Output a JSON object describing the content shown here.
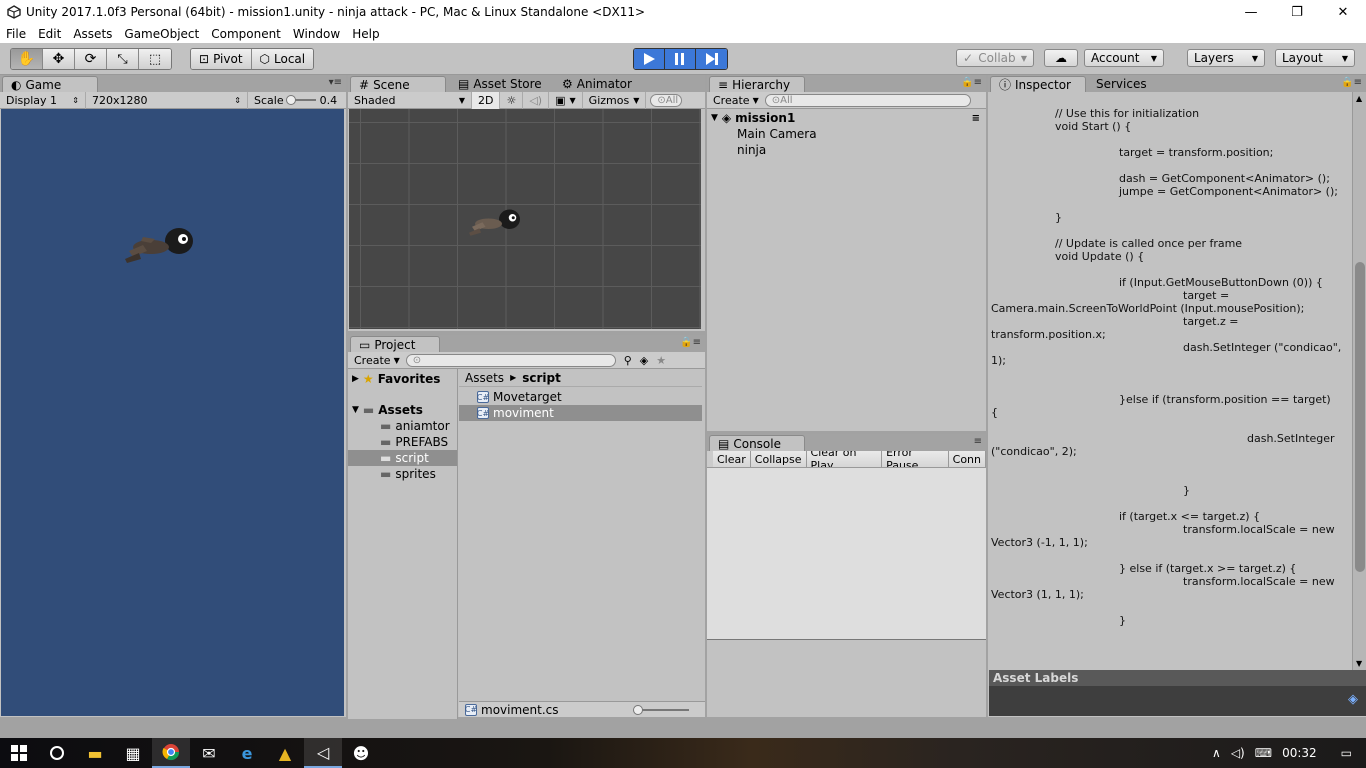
{
  "window": {
    "title": "Unity 2017.1.0f3 Personal (64bit) - mission1.unity - ninja attack - PC, Mac & Linux Standalone <DX11>",
    "controls": [
      "—",
      "❐",
      "✕"
    ]
  },
  "menu": [
    "File",
    "Edit",
    "Assets",
    "GameObject",
    "Component",
    "Window",
    "Help"
  ],
  "toolbar": {
    "pivot_label": "Pivot",
    "local_label": "Local",
    "collab_label": "Collab",
    "account_label": "Account",
    "layers_label": "Layers",
    "layout_label": "Layout"
  },
  "game": {
    "tab": "Game",
    "display": "Display 1",
    "resolution": "720x1280",
    "scale_label": "Scale",
    "scale_value": "0.4",
    "background_color": "#314d79"
  },
  "scene": {
    "tabs": [
      "Scene",
      "Asset Store",
      "Animator"
    ],
    "shading": "Shaded",
    "mode_2d": "2D",
    "gizmos": "Gizmos",
    "search_placeholder": "All"
  },
  "hierarchy": {
    "tab": "Hierarchy",
    "create": "Create",
    "search_placeholder": "All",
    "scene_name": "mission1",
    "items": [
      "Main Camera",
      "ninja"
    ]
  },
  "project": {
    "tab": "Project",
    "create": "Create",
    "favorites": "Favorites",
    "assets": "Assets",
    "folders": [
      "aniamtor",
      "PREFABS",
      "script",
      "sprites"
    ],
    "breadcrumb_root": "Assets",
    "breadcrumb_current": "script",
    "files": [
      "Movetarget",
      "moviment"
    ],
    "footer_file": "moviment.cs"
  },
  "console": {
    "tab": "Console",
    "buttons": [
      "Clear",
      "Collapse",
      "Clear on Play",
      "Error Pause",
      "Conn"
    ]
  },
  "inspector": {
    "tabs": [
      "Inspector",
      "Services"
    ],
    "asset_labels": "Asset Labels",
    "code_lines": [
      "// Use this for initialization",
      "void Start () {",
      "target = transform.position;",
      "dash = GetComponent<Animator> ();",
      "jumpe = GetComponent<Animator> ();",
      "}",
      "// Update is called once per frame",
      "void Update () {",
      "if (Input.GetMouseButtonDown (0)) {",
      "target =",
      "Camera.main.ScreenToWorldPoint (Input.mousePosition);",
      "target.z =",
      "transform.position.x;",
      "dash.SetInteger (\"condicao\",",
      "1);",
      "}else if (transform.position == target)",
      "{",
      "dash.SetInteger",
      "(\"condicao\", 2);",
      "}",
      "if (target.x <= target.z) {",
      "transform.localScale = new",
      "Vector3 (-1, 1, 1);",
      "} else if (target.x >= target.z) {",
      "transform.localScale = new",
      "Vector3 (1, 1, 1);",
      "}"
    ]
  },
  "taskbar": {
    "icons": [
      "windows-icon",
      "cortana-icon",
      "file-explorer-icon",
      "store-icon",
      "chrome-icon",
      "mail-icon",
      "edge-icon",
      "paint-icon",
      "unity-icon",
      "game-icon"
    ],
    "time": "00:32"
  },
  "colors": {
    "play_active": "#3c78d8",
    "editor_bg": "#c2c2c2",
    "scene_bg": "#474747"
  }
}
